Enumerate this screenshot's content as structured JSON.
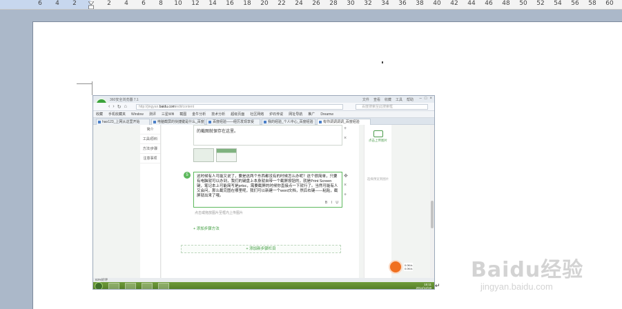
{
  "ruler": {
    "ticks": [
      "6",
      "4",
      "2",
      "2",
      "4",
      "6",
      "8",
      "10",
      "12",
      "14",
      "16",
      "18",
      "20",
      "22",
      "24",
      "26",
      "28",
      "30",
      "32",
      "34",
      "36",
      "38",
      "40",
      "42",
      "44",
      "46",
      "48",
      "50",
      "52",
      "54",
      "56",
      "58",
      "60"
    ]
  },
  "browser": {
    "title": "360安全浏览器 7.1",
    "menus": [
      "文件",
      "查看",
      "收藏",
      "工具",
      "帮助"
    ],
    "url_prefix": "http://jingyan.",
    "url_domain": "baidu.com",
    "url_path": "/edit/content",
    "search_placeholder": "百度搜索至此搜索框",
    "bookmarks": [
      "收藏",
      "手机收藏夹",
      "Window",
      "测评",
      "三星Wifi",
      "截图",
      "金牛分析",
      "技术分析",
      "超级页面",
      "社区网络",
      "炉石传说",
      "网址导航",
      "推广",
      "Dreamw"
    ],
    "tabs": [
      "hao123_上网从这里开始",
      "电脑截屏的快捷键是什么_百度...",
      "百度经验——经历发现享受",
      "我的经验_个人中心_百度经验",
      "有你调调调调_百度经验"
    ],
    "leftnav": [
      "简介",
      "工具/原料",
      "方法/步骤",
      "注意事项"
    ],
    "box1_text": "的截图就保存在这里。",
    "step_number": "5",
    "step_text": "这时候有人可能又说了，要是这两个东西都没有的时候怎么办呢？这个很简单，只要有电脑就可以办到，我们的键盘上本身就自带一个截屏按钮的，就是Print Screen键，笔记本上可能简写是prtsc，需要截屏的时候你直接点一下就行了。当然可能有人又会问，那么截完图在哪里呢，我们可以新建一个word文档，然后右键——粘贴，截屏就出来了哦。",
    "format_tools": "B I U",
    "hint": "点击或拖放图片至框内上传图片",
    "add_method": "+ 添加步骤方法",
    "add_step": "+ 添加新步骤栏目",
    "right_upload": "点击上传图片",
    "right_label2": "选择预览到图片",
    "status": "83%好评",
    "speed_up": "0.0K/s",
    "speed_down": "0.0K/s",
    "clock_time": "15:11",
    "clock_date": "2014/12/19"
  },
  "watermark": {
    "main": "Baidu经验",
    "sub": "jingyan.baidu.com"
  }
}
